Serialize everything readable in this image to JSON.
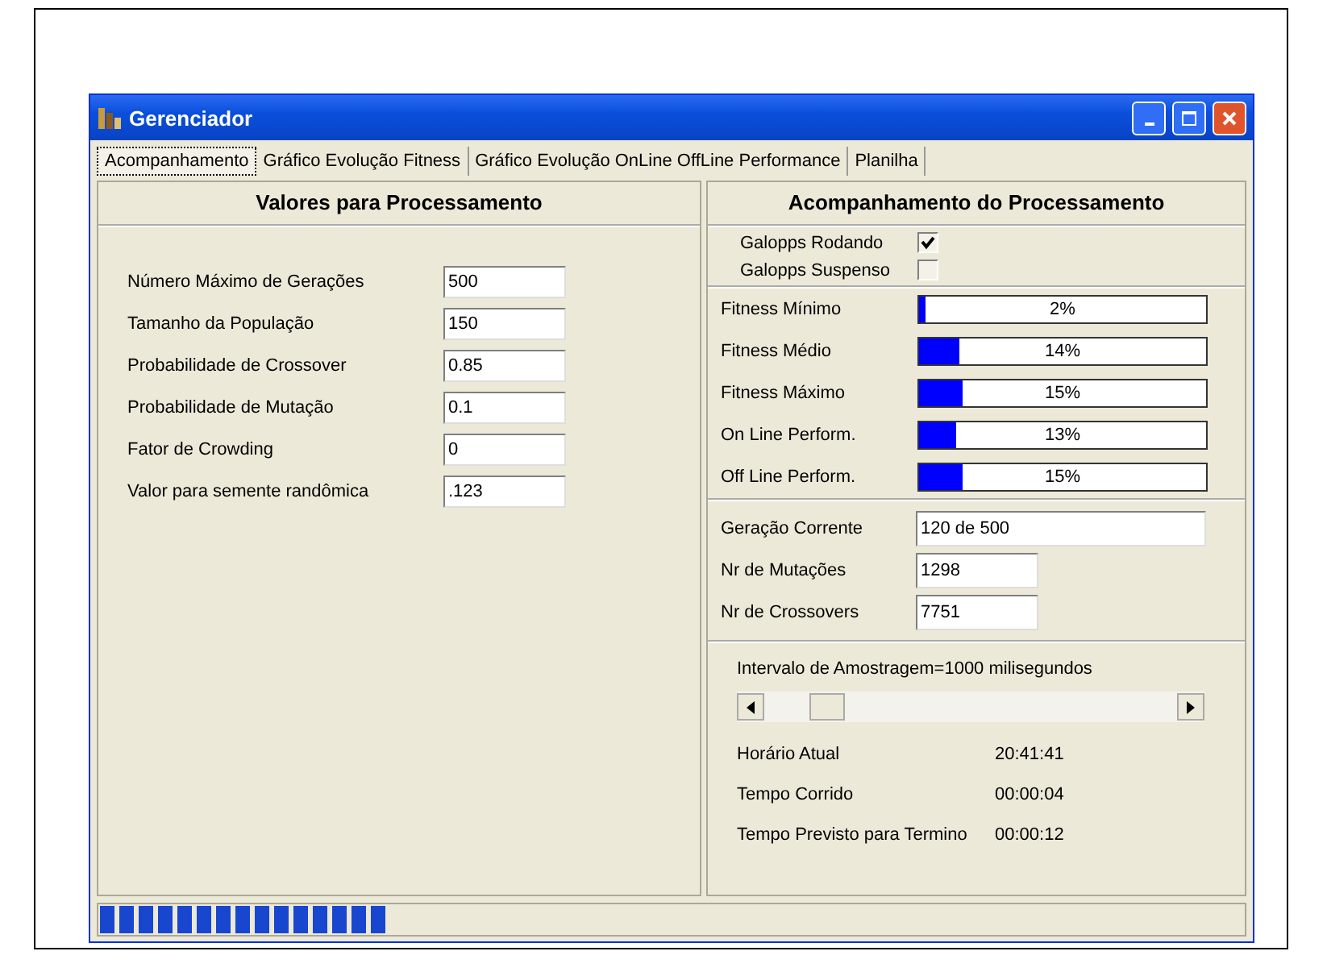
{
  "window": {
    "title": "Gerenciador"
  },
  "tabs": [
    {
      "label": "Acompanhamento",
      "selected": true
    },
    {
      "label": "Gráfico Evolução Fitness",
      "selected": false
    },
    {
      "label": "Gráfico Evolução OnLine OffLine Performance",
      "selected": false
    },
    {
      "label": "Planilha",
      "selected": false
    }
  ],
  "parameters": {
    "title": "Valores para Processamento",
    "fields": [
      {
        "label": "Número Máximo de Gerações",
        "value": "500"
      },
      {
        "label": "Tamanho da População",
        "value": "150"
      },
      {
        "label": "Probabilidade de Crossover",
        "value": "0.85"
      },
      {
        "label": "Probabilidade de Mutação",
        "value": "0.1"
      },
      {
        "label": "Fator de Crowding",
        "value": "0"
      },
      {
        "label": "Valor para semente randômica",
        "value": ".123"
      }
    ]
  },
  "monitor": {
    "title": "Acompanhamento do Processamento",
    "flags": [
      {
        "label": "Galopps Rodando",
        "checked": true
      },
      {
        "label": "Galopps Suspenso",
        "checked": false
      }
    ],
    "meters": [
      {
        "label": "Fitness Mínimo",
        "level": 0.02,
        "reading": "2%"
      },
      {
        "label": "Fitness Médio",
        "level": 0.14,
        "reading": "14%"
      },
      {
        "label": "Fitness Máximo",
        "level": 0.15,
        "reading": "15%"
      },
      {
        "label": "On Line Perform.",
        "level": 0.13,
        "reading": "13%"
      },
      {
        "label": "Off Line Perform.",
        "level": 0.15,
        "reading": "15%"
      }
    ],
    "counters": [
      {
        "label": "Geração Corrente",
        "value": "120 de 500"
      },
      {
        "label": "Nr de Mutações",
        "value": "1298"
      },
      {
        "label": "Nr de Crossovers",
        "value": "7751"
      }
    ],
    "interval": {
      "label": "Intervalo de Amostragem=1000 milisegundos",
      "level": 0.12
    },
    "times": [
      {
        "label": "Horário Atual",
        "value": "20:41:41"
      },
      {
        "label": "Tempo Corrido",
        "value": "00:00:04"
      },
      {
        "label": "Tempo Previsto para Termino",
        "value": "00:00:12"
      }
    ]
  },
  "status_bar": {
    "level": 0.25
  }
}
